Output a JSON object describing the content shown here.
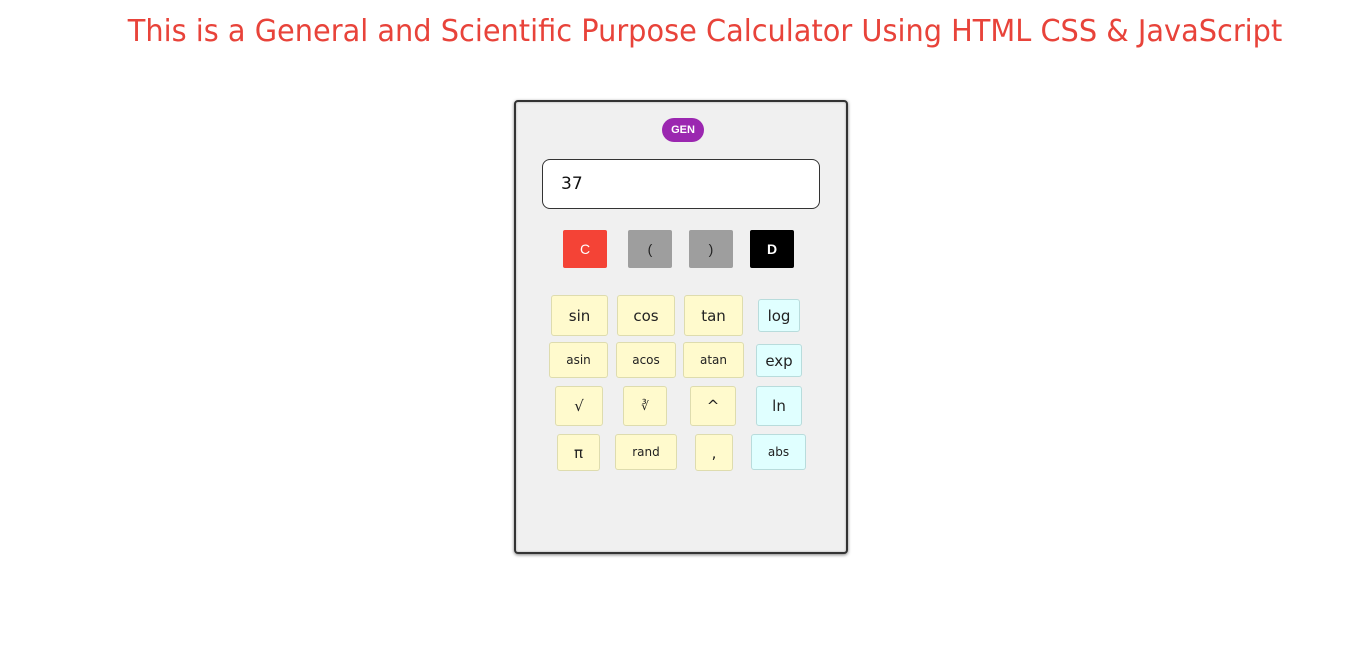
{
  "page": {
    "title": "This is a General and Scientific Purpose Calculator Using HTML CSS & JavaScript"
  },
  "calculator": {
    "mode_label": "GEN",
    "display_value": "37",
    "controls": {
      "clear": "C",
      "open_paren": "(",
      "close_paren": ")",
      "delete": "D"
    },
    "functions": {
      "sin": "sin",
      "cos": "cos",
      "tan": "tan",
      "log": "log",
      "asin": "asin",
      "acos": "acos",
      "atan": "atan",
      "exp": "exp",
      "sqrt": "√",
      "cbrt": "∛",
      "power": "^",
      "ln": "ln",
      "pi": "π",
      "rand": "rand",
      "comma": ",",
      "abs": "abs"
    }
  },
  "colors": {
    "title": "#e8433a",
    "mode_toggle": "#9b27b0",
    "clear_button": "#f44336",
    "paren_button": "#9e9e9e",
    "delete_button": "#000000",
    "function_button": "#fffacd",
    "log_function_button": "#e0ffff"
  }
}
